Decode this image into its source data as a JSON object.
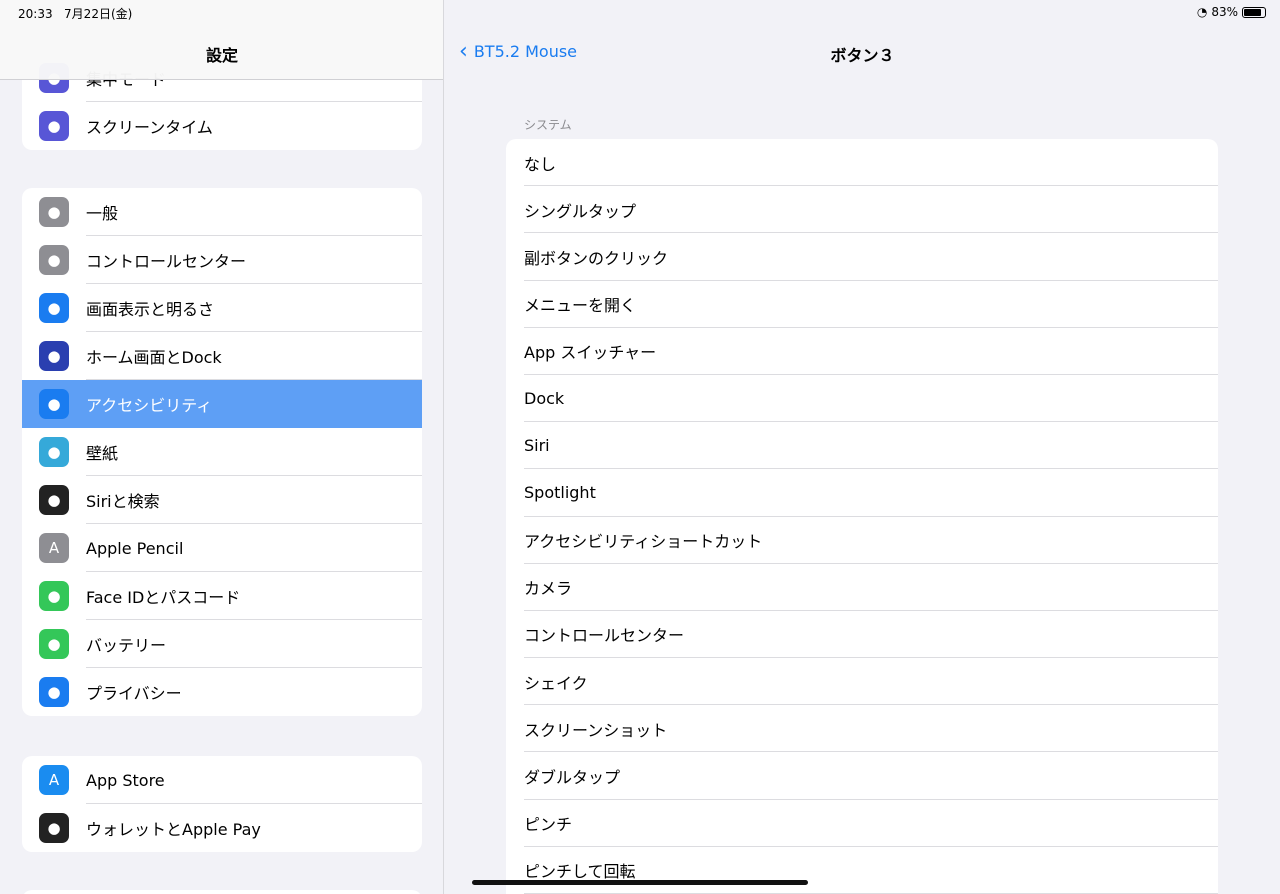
{
  "status": {
    "time": "20:33",
    "date": "7月22日(金)",
    "battery": "83%",
    "battery_level": 0.83
  },
  "sidebar": {
    "title": "設定",
    "group1": [
      {
        "label": "集中モード",
        "icon": "moon-icon",
        "color": "#5856d6"
      },
      {
        "label": "スクリーンタイム",
        "icon": "hourglass-icon",
        "color": "#5856d6"
      }
    ],
    "group2": [
      {
        "label": "一般",
        "icon": "gear-icon",
        "color": "#8e8e93"
      },
      {
        "label": "コントロールセンター",
        "icon": "toggles-icon",
        "color": "#8e8e93"
      },
      {
        "label": "画面表示と明るさ",
        "icon": "text-size-icon",
        "color": "#1a7cf0"
      },
      {
        "label": "ホーム画面とDock",
        "icon": "home-grid-icon",
        "color": "#2a3fb0"
      },
      {
        "label": "アクセシビリティ",
        "icon": "accessibility-icon",
        "color": "#1a7cf0",
        "selected": true
      },
      {
        "label": "壁紙",
        "icon": "flower-icon",
        "color": "#35a9d9"
      },
      {
        "label": "Siriと検索",
        "icon": "siri-icon",
        "color": "#222"
      },
      {
        "label": "Apple Pencil",
        "icon": "pencil-icon",
        "color": "#8e8e93"
      },
      {
        "label": "Face IDとパスコード",
        "icon": "face-id-icon",
        "color": "#34c759"
      },
      {
        "label": "バッテリー",
        "icon": "battery-icon",
        "color": "#34c759"
      },
      {
        "label": "プライバシー",
        "icon": "hand-icon",
        "color": "#1a7cf0"
      }
    ],
    "group3": [
      {
        "label": "App Store",
        "icon": "app-store-icon",
        "color": "#1a8cf0"
      },
      {
        "label": "ウォレットとApple Pay",
        "icon": "wallet-icon",
        "color": "#222"
      }
    ]
  },
  "main": {
    "back_label": "BT5.2 Mouse",
    "title": "ボタン３",
    "section": "システム",
    "items": [
      "なし",
      "シングルタップ",
      "副ボタンのクリック",
      "メニューを開く",
      "App スイッチャー",
      "Dock",
      "Siri",
      "Spotlight",
      "アクセシビリティショートカット",
      "カメラ",
      "コントロールセンター",
      "シェイク",
      "スクリーンショット",
      "ダブルタップ",
      "ピンチ",
      "ピンチして回転"
    ]
  }
}
